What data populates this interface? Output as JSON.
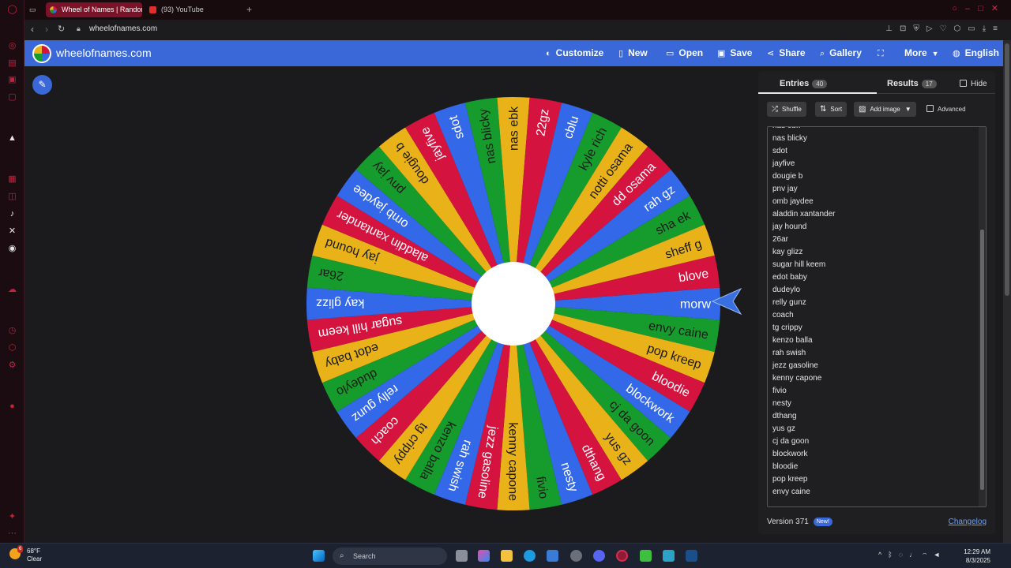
{
  "browser": {
    "tabs": [
      {
        "label": "Wheel of Names | Random",
        "active": true,
        "favicon": "wheel-favicon"
      },
      {
        "label": "(93) YouTube",
        "active": false,
        "favicon": "youtube-favicon"
      }
    ],
    "url": "wheelofnames.com"
  },
  "site": {
    "title": "wheelofnames.com",
    "nav": {
      "customize": "Customize",
      "new": "New",
      "open": "Open",
      "save": "Save",
      "share": "Share",
      "gallery": "Gallery",
      "more": "More",
      "language": "English"
    }
  },
  "wheel": {
    "colors": [
      "#3368e8",
      "#169c2c",
      "#e9b218",
      "#d5133f"
    ],
    "text_colors": {
      "#3368e8": "#ffffff",
      "#169c2c": "#1a1a1a",
      "#e9b218": "#1a1a1a",
      "#d5133f": "#ffffff"
    },
    "segments": [
      "morw",
      "envy caine",
      "pop kreep",
      "bloodie",
      "blockwork",
      "cj da goon",
      "yus gz",
      "dthang",
      "nesty",
      "fivio",
      "kenny capone",
      "jezz gasoline",
      "rah swish",
      "kenzo balla",
      "tg crippy",
      "coach",
      "relly gunz",
      "dudeylo",
      "edot baby",
      "sugar hill keem",
      "kay glizz",
      "26ar",
      "jay hound",
      "aladdin xantander",
      "omb jaydee",
      "pnv jay",
      "dougie b",
      "jayfive",
      "sdot",
      "nas blicky",
      "nas ebk",
      "22gz",
      "cblu",
      "kyle rich",
      "notti osama",
      "dd osama",
      "rah gz",
      "sha ek",
      "sheff g",
      "blove"
    ]
  },
  "panel": {
    "tab_entries": "Entries",
    "entries_count": "40",
    "tab_results": "Results",
    "results_count": "17",
    "hide_label": "Hide",
    "shuffle": "Shuffle",
    "sort": "Sort",
    "add_image": "Add image",
    "advanced": "Advanced",
    "entries": [
      "nas ebk",
      "nas blicky",
      "sdot",
      "jayfive",
      "dougie b",
      "pnv jay",
      "omb jaydee",
      "aladdin xantander",
      "jay hound",
      "26ar",
      "kay glizz",
      "sugar hill keem",
      "edot baby",
      "dudeylo",
      "relly gunz",
      "coach",
      "tg crippy",
      "kenzo balla",
      "rah swish",
      "jezz gasoline",
      "kenny capone",
      "fivio",
      "nesty",
      "dthang",
      "yus gz",
      "cj da goon",
      "blockwork",
      "bloodie",
      "pop kreep",
      "envy caine"
    ],
    "version": "Version 371",
    "new_badge": "New!",
    "changelog": "Changelog"
  },
  "taskbar": {
    "weather_temp": "68°F",
    "weather_desc": "Clear",
    "weather_alert": "6",
    "search": "Search",
    "time": "12:29 AM",
    "date": "8/3/2025"
  }
}
